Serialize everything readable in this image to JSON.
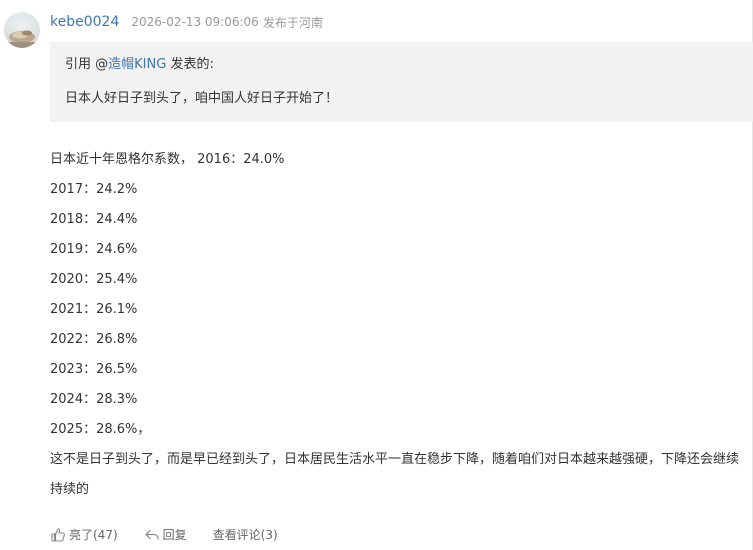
{
  "post": {
    "username": "kebe0024",
    "timestamp": "2026-02-13 09:06:06",
    "location": "发布于河南"
  },
  "quote": {
    "prefix": "引用 @",
    "author": "造帽KING",
    "suffix": " 发表的:",
    "text": "日本人好日子到头了，咱中国人好日子开始了！"
  },
  "body": {
    "lines": [
      "日本近十年恩格尔系数， 2016：24.0%",
      "2017：24.2%",
      "2018：24.4%",
      "2019：24.6%",
      "2020：25.4%",
      "2021：26.1%",
      "2022：26.8%",
      "2023：26.5%",
      "2024：28.3%",
      "2025：28.6%，"
    ],
    "paragraph": "这不是日子到头了，而是早已经到头了，日本居民生活水平一直在稳步下降，随着咱们对日本越来越强硬，下降还会继续持续的"
  },
  "actions": {
    "like_label": "亮了(47)",
    "like_icon": "thumbs-up-icon",
    "reply_label": "回复",
    "reply_icon": "reply-arrow-icon",
    "comments_label": "查看评论(3)"
  },
  "colors": {
    "link": "#3f76b0",
    "muted": "#999999",
    "quote_bg": "#f2f2f2"
  }
}
